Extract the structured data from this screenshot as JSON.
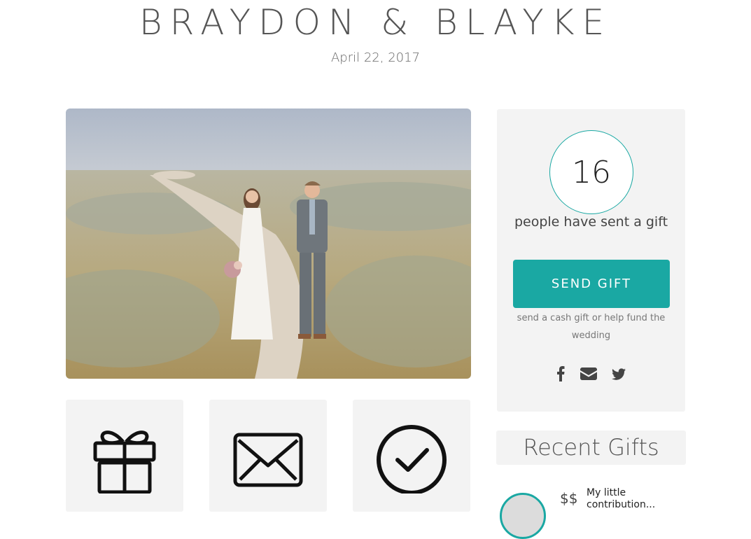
{
  "header": {
    "title": "BRAYDON & BLAYKE",
    "date": "April 22, 2017"
  },
  "hero_photo": {
    "description_icon": "wedding-couple-photo"
  },
  "tiles": [
    {
      "icon": "gift-icon"
    },
    {
      "icon": "envelope-icon"
    },
    {
      "icon": "checkmark-circle-icon"
    }
  ],
  "sidebar": {
    "gift_count": "16",
    "gift_count_label": "people have sent a gift",
    "send_button_label": "SEND GIFT",
    "send_subtext": "send a cash gift or help fund the wedding",
    "social": [
      {
        "icon": "facebook-icon"
      },
      {
        "icon": "email-icon"
      },
      {
        "icon": "twitter-icon"
      }
    ]
  },
  "recent_gifts": {
    "heading": "Recent Gifts",
    "items": [
      {
        "amount": "$$",
        "message": "My little contribution..."
      }
    ]
  },
  "colors": {
    "accent": "#1aa8a3",
    "panel": "#f3f3f3",
    "title": "#555555"
  }
}
